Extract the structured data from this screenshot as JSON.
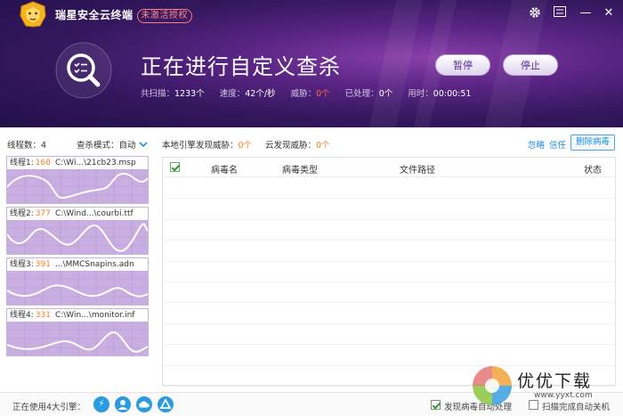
{
  "app": {
    "name": "瑞星安全云终端",
    "activation_badge": "未激活授权"
  },
  "window_controls": {
    "settings_icon": "gear-icon",
    "menu_icon": "menu-icon",
    "minimize": "—",
    "close": "✕"
  },
  "scan": {
    "title": "正在进行自定义查杀",
    "pause_label": "暂停",
    "stop_label": "停止",
    "stats": [
      {
        "label": "共扫描：",
        "value": "1233个"
      },
      {
        "label": "速度：",
        "value": "42个/秒"
      },
      {
        "label": "威胁：",
        "value": "0个",
        "danger": true
      },
      {
        "label": "已处理：",
        "value": "0个"
      },
      {
        "label": "用时：",
        "value": "00:00:51"
      }
    ]
  },
  "toolbar": {
    "threads_label": "线程数：",
    "threads_value": "4",
    "mode_label": "查杀模式：",
    "mode_value": "自动",
    "local_label": "本地引擎发现威胁：",
    "local_value": "0个",
    "cloud_label": "云发现威胁：",
    "cloud_value": "0个",
    "ignore_label": "忽略",
    "trust_label": "信任",
    "delete_label": "删除病毒"
  },
  "threads": [
    {
      "label": "线程1:",
      "count": "168",
      "path": "C:\\Wi...\\21cb23.msp"
    },
    {
      "label": "线程2:",
      "count": "377",
      "path": "C:\\Wind...\\courbi.ttf"
    },
    {
      "label": "线程3:",
      "count": "391",
      "path": "...\\MMCSnapins.adn"
    },
    {
      "label": "线程4:",
      "count": "331",
      "path": "C:\\Win...\\monitor.inf"
    }
  ],
  "table": {
    "columns": [
      "病毒名",
      "病毒类型",
      "文件路径",
      "状态"
    ],
    "rows": []
  },
  "footer": {
    "engines_label": "正在使用4大引擎：",
    "auto_handle_label": "发现病毒自动处理",
    "auto_handle_checked": true,
    "shutdown_label": "扫描完成自动关机",
    "shutdown_checked": false
  },
  "watermark": {
    "text": "优优下载",
    "url": "www.yyxt.com"
  },
  "colors": {
    "header_dark": "#22104a",
    "header_glow": "#8a3fa8",
    "accent_orange": "#ff7a22",
    "link_blue": "#1d8fe0",
    "chart_fill": "#c9aee2"
  }
}
